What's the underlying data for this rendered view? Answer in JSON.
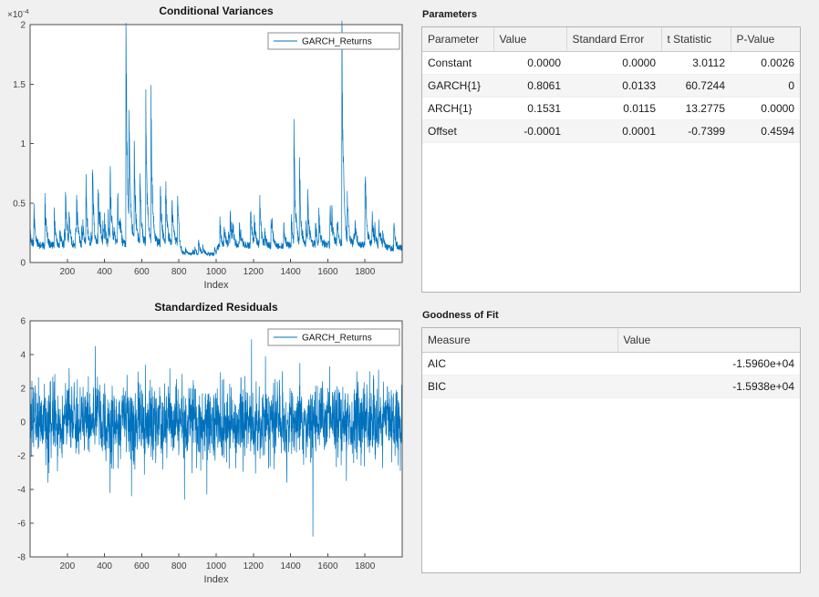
{
  "window": {
    "background": "#f0f0f0",
    "accent_blue": "#0072bd"
  },
  "panels": {
    "parameters": {
      "title": "Parameters",
      "table": {
        "columns": [
          "Parameter",
          "Value",
          "Standard Error",
          "t Statistic",
          "P-Value"
        ],
        "rows": [
          [
            "Constant",
            "0.0000",
            "0.0000",
            "3.0112",
            "0.0026"
          ],
          [
            "GARCH{1}",
            "0.8061",
            "0.0133",
            "60.7244",
            "0"
          ],
          [
            "ARCH{1}",
            "0.1531",
            "0.0115",
            "13.2775",
            "0.0000"
          ],
          [
            "Offset",
            "-0.0001",
            "0.0001",
            "-0.7399",
            "0.4594"
          ]
        ]
      }
    },
    "goodness_of_fit": {
      "title": "Goodness of Fit",
      "table": {
        "columns": [
          "Measure",
          "Value"
        ],
        "rows": [
          [
            "AIC",
            "-1.5960e+04"
          ],
          [
            "BIC",
            "-1.5938e+04"
          ]
        ]
      }
    }
  },
  "chart_data": [
    {
      "type": "line",
      "name": "conditional-variances",
      "title": "Conditional Variances",
      "xlabel": "Index",
      "legend": [
        "GARCH_Returns"
      ],
      "legend_position": "top-right",
      "line_color": "#0072bd",
      "grid": false,
      "n_points": 2000,
      "x_range": [
        0,
        2000
      ],
      "xticks": [
        200,
        400,
        600,
        800,
        1000,
        1200,
        1400,
        1600,
        1800
      ],
      "ylim": [
        0,
        2
      ],
      "yticks": [
        0,
        0.5,
        1,
        1.5,
        2
      ],
      "y_unit_exponent": {
        "base": "×10",
        "power": "-4"
      },
      "series_summary": {
        "kind": "garch_variance",
        "units": "1e-4",
        "seed": 1234,
        "decay": 0.88,
        "minor_spike_prob": 0.035,
        "minor_spike_scale": 1.6,
        "baseline_segments": [
          {
            "to": 500,
            "level": 0.14
          },
          {
            "to": 800,
            "level": 0.16
          },
          {
            "to": 1000,
            "level": 0.07
          },
          {
            "to": 1400,
            "level": 0.14
          },
          {
            "to": 1860,
            "level": 0.15
          },
          {
            "to": 2000,
            "level": 0.12
          }
        ],
        "spikes": [
          {
            "x": 20,
            "v": 0.45
          },
          {
            "x": 80,
            "v": 0.52
          },
          {
            "x": 130,
            "v": 0.4
          },
          {
            "x": 190,
            "v": 0.63
          },
          {
            "x": 250,
            "v": 0.55
          },
          {
            "x": 300,
            "v": 0.68
          },
          {
            "x": 335,
            "v": 0.78
          },
          {
            "x": 365,
            "v": 0.7
          },
          {
            "x": 430,
            "v": 0.78
          },
          {
            "x": 470,
            "v": 0.6
          },
          {
            "x": 515,
            "v": 1.85
          },
          {
            "x": 532,
            "v": 1.42
          },
          {
            "x": 560,
            "v": 0.9
          },
          {
            "x": 590,
            "v": 0.72
          },
          {
            "x": 622,
            "v": 1.22
          },
          {
            "x": 650,
            "v": 1.25
          },
          {
            "x": 700,
            "v": 0.62
          },
          {
            "x": 728,
            "v": 0.7
          },
          {
            "x": 762,
            "v": 0.5
          },
          {
            "x": 792,
            "v": 0.55
          },
          {
            "x": 905,
            "v": 0.18
          },
          {
            "x": 1020,
            "v": 0.32
          },
          {
            "x": 1075,
            "v": 0.46
          },
          {
            "x": 1125,
            "v": 0.3
          },
          {
            "x": 1185,
            "v": 0.45
          },
          {
            "x": 1235,
            "v": 0.48
          },
          {
            "x": 1295,
            "v": 0.36
          },
          {
            "x": 1418,
            "v": 1.0
          },
          {
            "x": 1448,
            "v": 0.78
          },
          {
            "x": 1492,
            "v": 0.55
          },
          {
            "x": 1552,
            "v": 0.42
          },
          {
            "x": 1612,
            "v": 0.46
          },
          {
            "x": 1676,
            "v": 1.9
          },
          {
            "x": 1705,
            "v": 0.55
          },
          {
            "x": 1800,
            "v": 0.82
          },
          {
            "x": 1852,
            "v": 0.3
          }
        ]
      }
    },
    {
      "type": "line",
      "name": "standardized-residuals",
      "title": "Standardized Residuals",
      "xlabel": "Index",
      "legend": [
        "GARCH_Returns"
      ],
      "legend_position": "top-right",
      "line_color": "#0072bd",
      "grid": false,
      "n_points": 2000,
      "x_range": [
        0,
        2000
      ],
      "xticks": [
        200,
        400,
        600,
        800,
        1000,
        1200,
        1400,
        1600,
        1800
      ],
      "ylim": [
        -8,
        6
      ],
      "yticks": [
        -8,
        -6,
        -4,
        -2,
        0,
        2,
        4,
        6
      ],
      "series_summary": {
        "kind": "white_noise",
        "seed": 77,
        "sigma": 1.12,
        "clip": 3.2,
        "spikes": [
          {
            "x": 95,
            "v": -3.6
          },
          {
            "x": 210,
            "v": 3.2
          },
          {
            "x": 350,
            "v": 4.5
          },
          {
            "x": 430,
            "v": -4.2
          },
          {
            "x": 545,
            "v": -4.4
          },
          {
            "x": 620,
            "v": 3.4
          },
          {
            "x": 830,
            "v": -4.6
          },
          {
            "x": 950,
            "v": -4.3
          },
          {
            "x": 1190,
            "v": 4.9
          },
          {
            "x": 1265,
            "v": 3.9
          },
          {
            "x": 1380,
            "v": -3.6
          },
          {
            "x": 1450,
            "v": 3.5
          },
          {
            "x": 1520,
            "v": -6.8
          },
          {
            "x": 1610,
            "v": 3.3
          },
          {
            "x": 1700,
            "v": -3.5
          }
        ]
      }
    }
  ]
}
